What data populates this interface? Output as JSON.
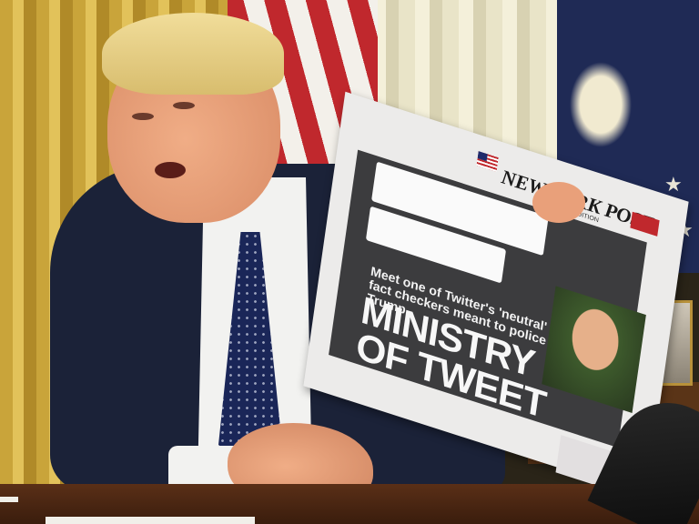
{
  "newspaper": {
    "masthead": "NEW YORK POST",
    "edition": "METRO EDITION",
    "subheadline": "Meet one of Twitter's 'neutral' fact checkers meant to police Trump",
    "headline_line1": "MINISTRY",
    "headline_line2": "OF TWEET"
  },
  "colors": {
    "suit": "#1b2238",
    "tie": "#1a2658",
    "curtain_gold": "#c9a43a",
    "flag_red": "#c0282d",
    "flag_blue": "#1f2a55",
    "desk_wood": "#5a2f17"
  }
}
